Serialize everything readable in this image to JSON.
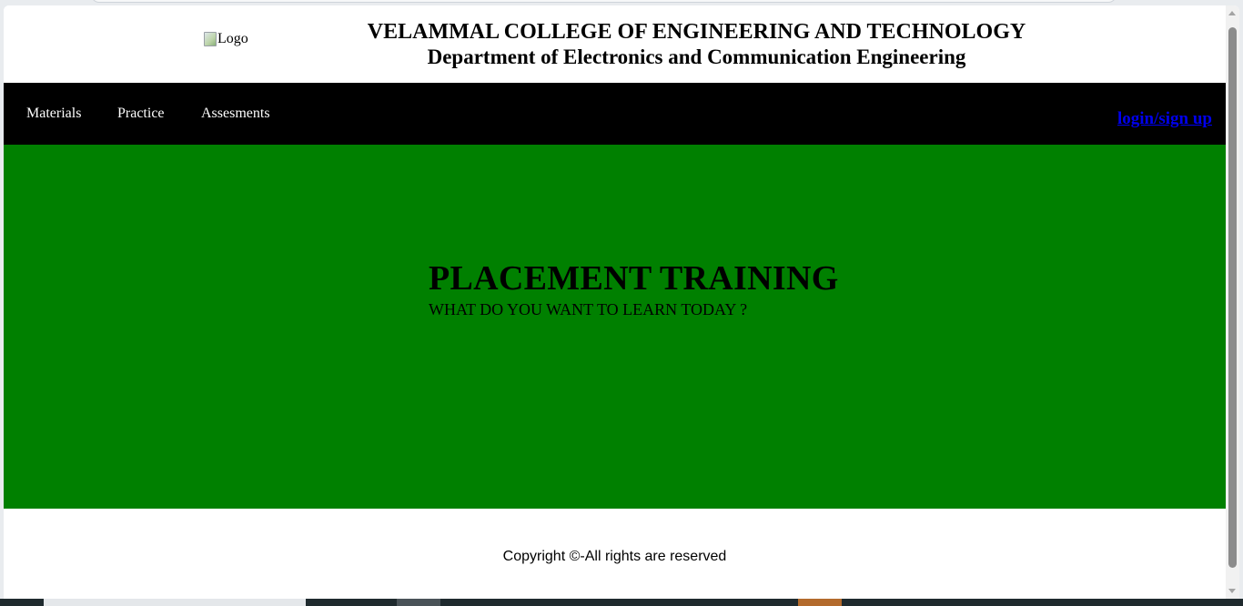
{
  "header": {
    "logo_alt": "Logo",
    "college_name": "VELAMMAL COLLEGE OF ENGINEERING AND TECHNOLOGY",
    "department": "Department of Electronics and Communication Engineering"
  },
  "nav": {
    "items": [
      {
        "label": "Materials"
      },
      {
        "label": "Practice"
      },
      {
        "label": "Assesments"
      }
    ],
    "login_label": "login/sign up"
  },
  "hero": {
    "title": "PLACEMENT TRAINING",
    "subtitle": "WHAT DO YOU WANT TO LEARN TODAY ?",
    "background_color": "#008000"
  },
  "footer": {
    "copyright": "Copyright ©-All rights are reserved"
  },
  "colors": {
    "navbar": "#000000",
    "link": "#0000ee",
    "hero": "#008000"
  }
}
